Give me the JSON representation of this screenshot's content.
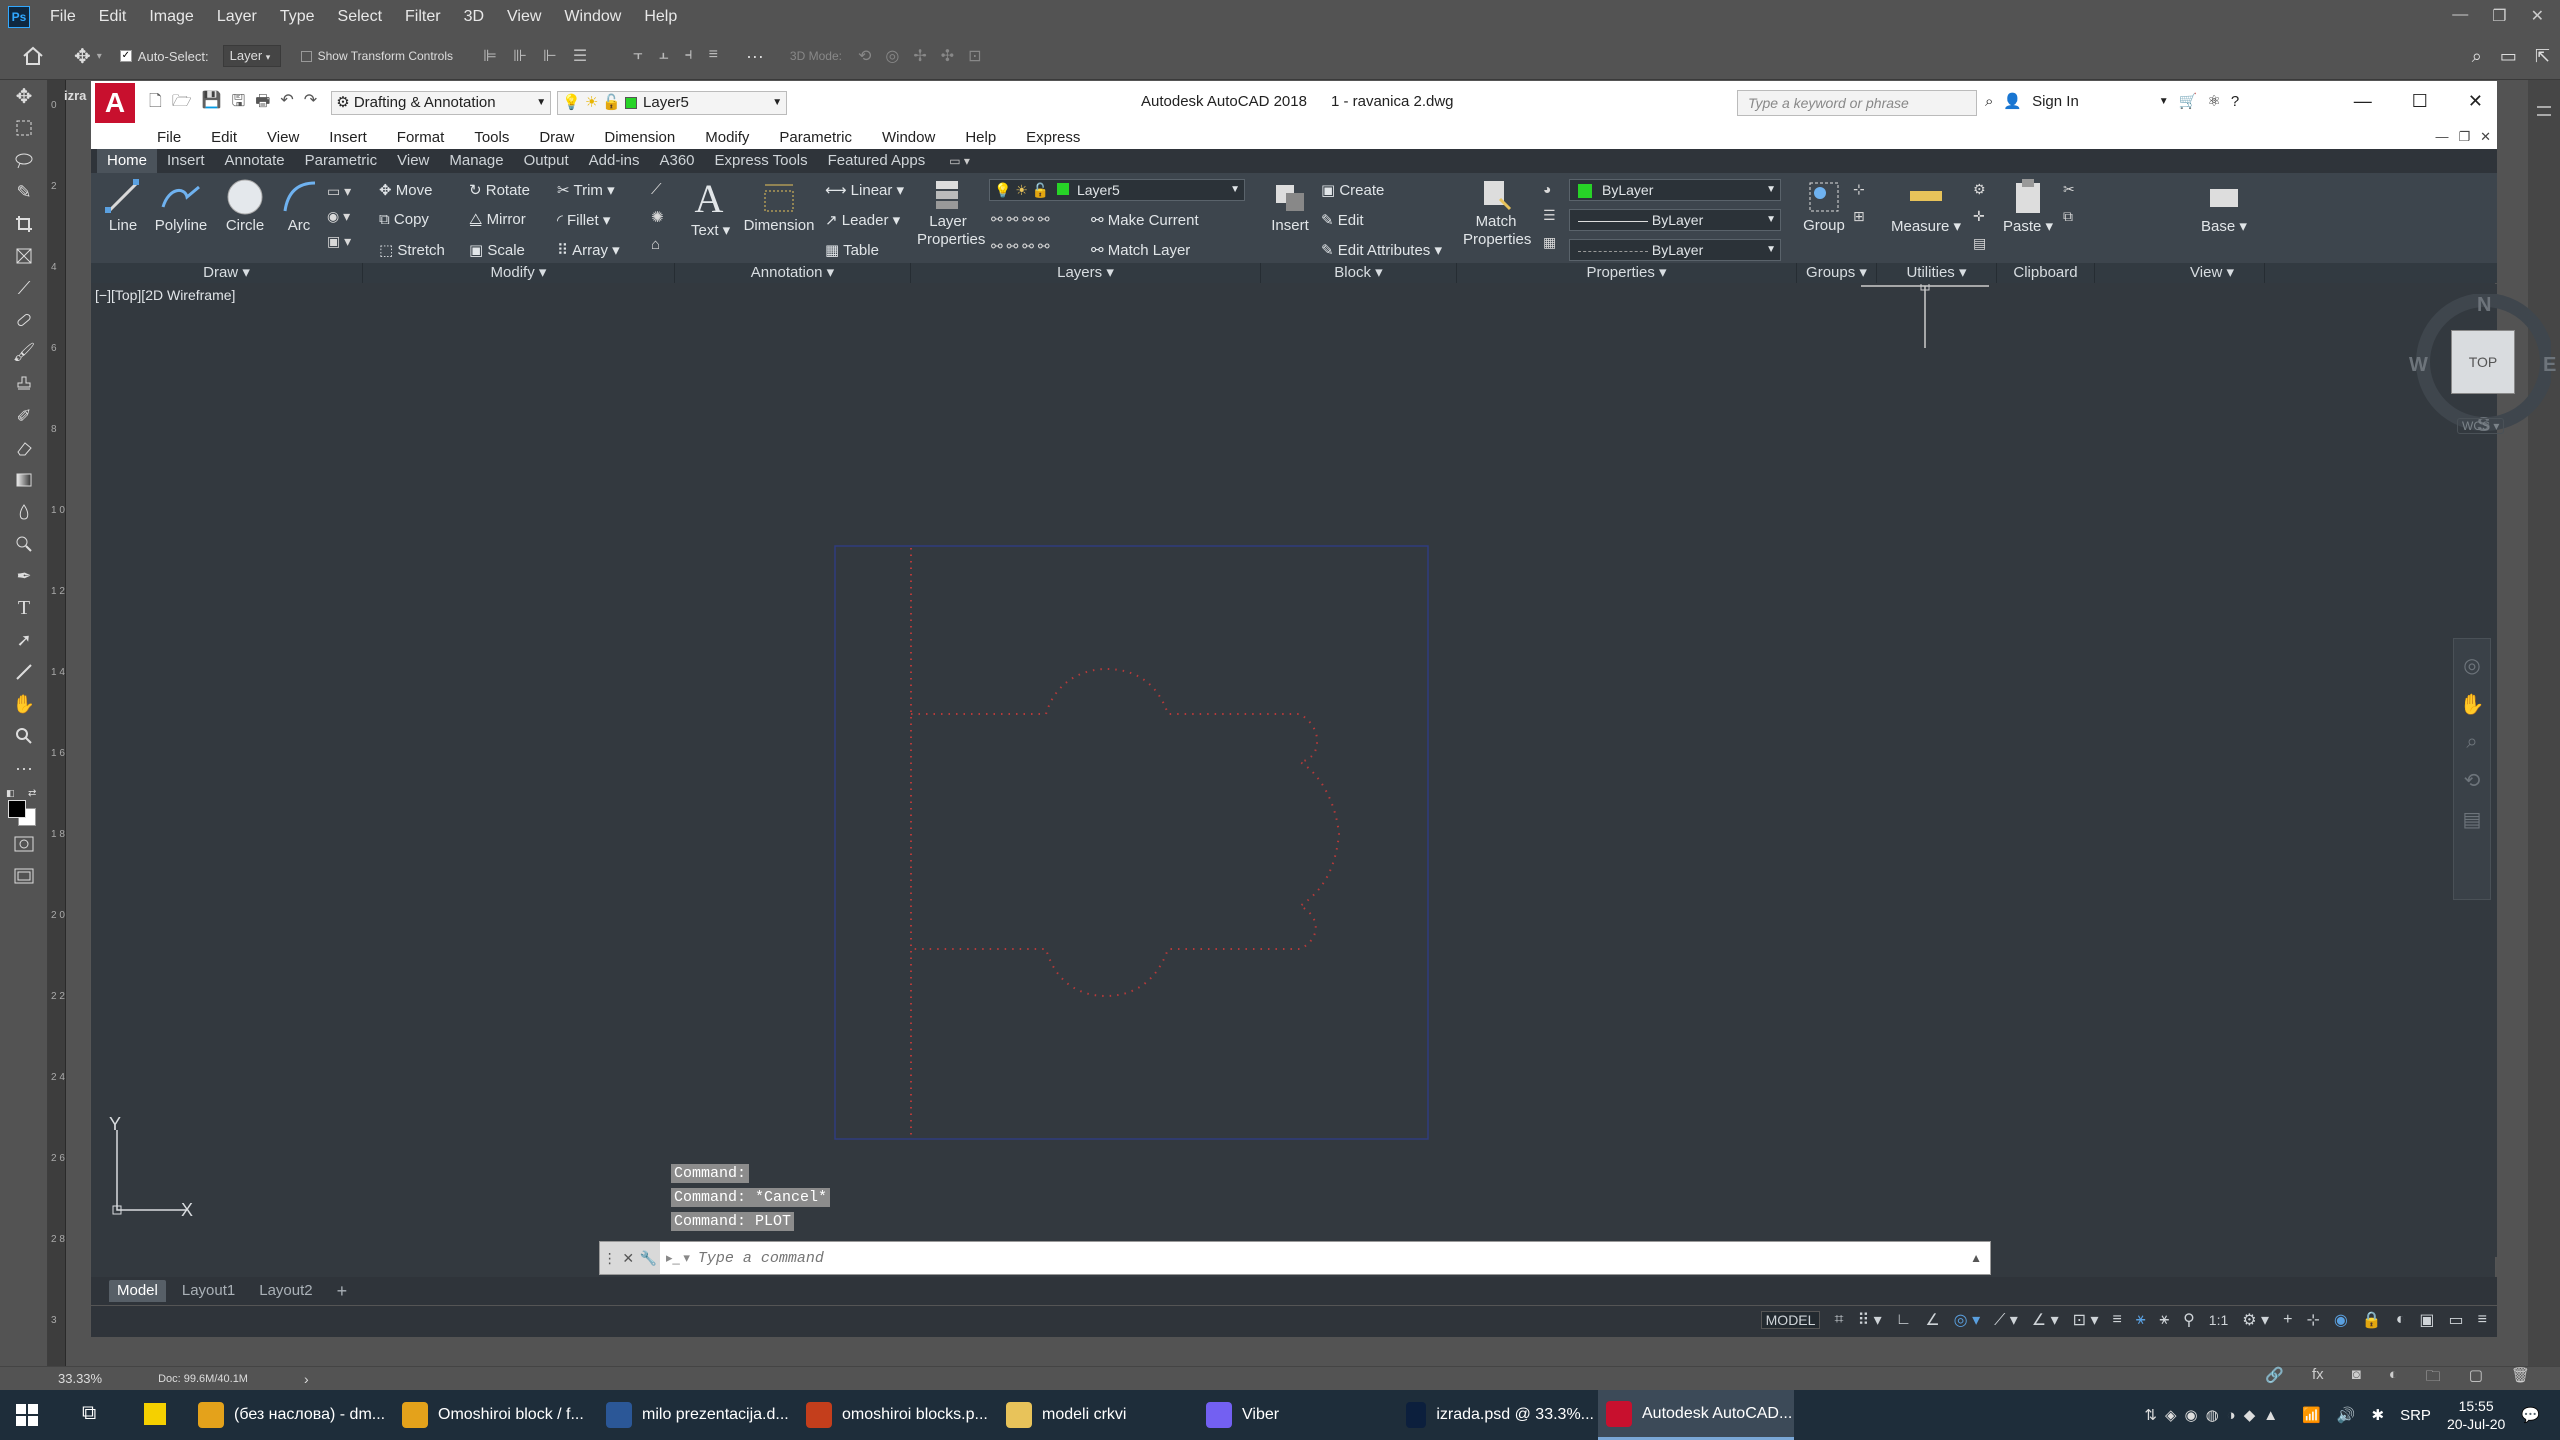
{
  "photoshop": {
    "menu": [
      "File",
      "Edit",
      "Image",
      "Layer",
      "Type",
      "Select",
      "Filter",
      "3D",
      "View",
      "Window",
      "Help"
    ],
    "options": {
      "auto_select_label": "Auto-Select:",
      "auto_select_value": "Layer",
      "transform_controls_label": "Show Transform Controls",
      "mode_3d": "3D Mode:",
      "ellipsis": "···"
    },
    "doc_tab_label": "izra",
    "ruler_labels": [
      "0",
      "2",
      "4",
      "6",
      "8",
      "1 0",
      "1 2",
      "1 4",
      "1 6",
      "1 8",
      "2 0",
      "2 2",
      "2 4",
      "2 6",
      "2 8",
      "3"
    ],
    "status": {
      "zoom": "33.33%",
      "doc": "Doc: 99.6M/40.1M",
      "arrow": "›"
    }
  },
  "acad": {
    "title": {
      "app": "Autodesk AutoCAD 2018",
      "file": "1 - ravanica 2.dwg",
      "search_placeholder": "Type a keyword or phrase",
      "sign_in": "Sign In",
      "workspace": "Drafting & Annotation",
      "layer": "Layer5"
    },
    "menu": [
      "File",
      "Edit",
      "View",
      "Insert",
      "Format",
      "Tools",
      "Draw",
      "Dimension",
      "Modify",
      "Parametric",
      "Window",
      "Help",
      "Express"
    ],
    "ribbon_tabs": [
      "Home",
      "Insert",
      "Annotate",
      "Parametric",
      "View",
      "Manage",
      "Output",
      "Add-ins",
      "A360",
      "Express Tools",
      "Featured Apps"
    ],
    "ribbon": {
      "draw": {
        "line": "Line",
        "polyline": "Polyline",
        "circle": "Circle",
        "arc": "Arc",
        "panel": "Draw"
      },
      "modify": {
        "move": "Move",
        "rotate": "Rotate",
        "trim": "Trim",
        "copy": "Copy",
        "mirror": "Mirror",
        "fillet": "Fillet",
        "stretch": "Stretch",
        "scale": "Scale",
        "array": "Array",
        "panel": "Modify"
      },
      "annotation": {
        "text": "Text",
        "dimension": "Dimension",
        "linear": "Linear",
        "leader": "Leader",
        "table": "Table",
        "panel": "Annotation"
      },
      "layers": {
        "layer_properties": "Layer Properties",
        "layer_value": "Layer5",
        "make_current": "Make Current",
        "match_layer": "Match Layer",
        "panel": "Layers"
      },
      "block": {
        "insert": "Insert",
        "create": "Create",
        "edit": "Edit",
        "edit_attributes": "Edit Attributes",
        "panel": "Block"
      },
      "properties": {
        "match_properties": "Match Properties",
        "color": "ByLayer",
        "linetype": "ByLayer",
        "lineweight": "ByLayer",
        "panel": "Properties"
      },
      "groups": {
        "group": "Group",
        "panel": "Groups"
      },
      "utilities": {
        "measure": "Measure",
        "panel": "Utilities"
      },
      "clipboard": {
        "paste": "Paste",
        "panel": "Clipboard"
      },
      "view": {
        "base": "Base",
        "panel": "View"
      }
    },
    "viewport_label": "[−][Top][2D Wireframe]",
    "viewcube": {
      "n": "N",
      "s": "S",
      "e": "E",
      "w": "W",
      "top": "TOP",
      "wcs": "WCS"
    },
    "ucs": {
      "x": "X",
      "y": "Y"
    },
    "command_history": [
      "Command:",
      "Command: *Cancel*",
      "Command: PLOT"
    ],
    "command_placeholder": "Type a command",
    "layout_tabs": [
      "Model",
      "Layout1",
      "Layout2"
    ],
    "status": {
      "model": "MODEL",
      "scale": "1:1"
    }
  },
  "taskbar": {
    "apps": [
      {
        "label": "(без наслова) - dm...",
        "color": "#e4a21b"
      },
      {
        "label": "Omoshiroi block / f...",
        "color": "#e4a21b"
      },
      {
        "label": "milo prezentacija.d...",
        "color": "#2b5797"
      },
      {
        "label": "omoshiroi blocks.p...",
        "color": "#c43e1c"
      },
      {
        "label": "modeli crkvi",
        "color": "#e8c35a"
      },
      {
        "label": "Viber",
        "color": "#7360f2"
      },
      {
        "label": "izrada.psd @ 33.3%...",
        "color": "#0c1f3d"
      },
      {
        "label": "Autodesk AutoCAD...",
        "color": "#c8102e"
      }
    ],
    "lang": "SRP",
    "time": "15:55",
    "date": "20-Jul-20"
  }
}
